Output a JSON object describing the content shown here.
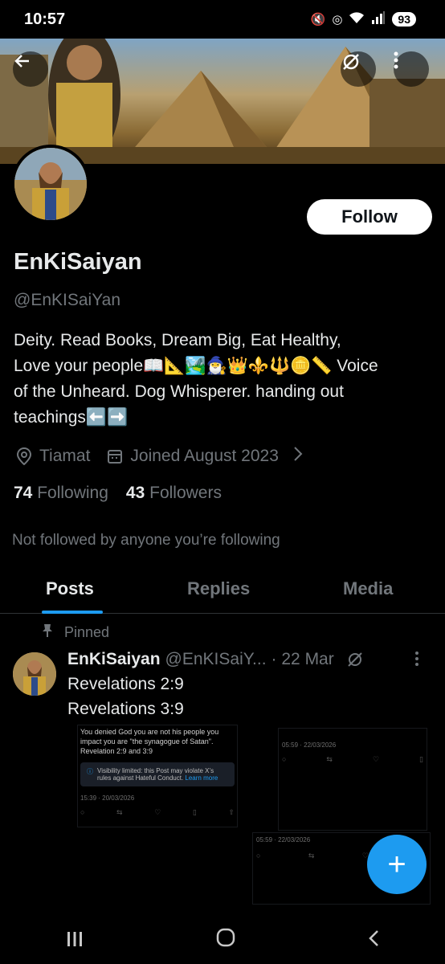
{
  "status": {
    "time": "10:57",
    "battery": "93",
    "icons": [
      "mute-icon",
      "hotspot-icon",
      "wifi-icon",
      "signal-icon"
    ]
  },
  "header": {
    "back_icon": "back-arrow-icon",
    "hide_icon": "eye-slash-icon",
    "more_icon": "more-vertical-icon"
  },
  "profile": {
    "name": "EnKiSaiyan",
    "handle": "@EnKISaiYan",
    "bio_line1": "Deity.   Read Books, Dream Big, Eat Healthy,",
    "bio_line2": "Love your people📖📐🏞️🧙‍♂️👑⚜️🔱🪙📏 Voice",
    "bio_line3": "of the Unheard.   Dog Whisperer.   handing out",
    "bio_line4": "teachings⬅️➡️",
    "location": "Tiamat",
    "joined": "Joined August 2023",
    "following_count": "74",
    "following_label": "Following",
    "followers_count": "43",
    "followers_label": "Followers",
    "not_followed": "Not followed by anyone you’re following",
    "follow_button": "Follow"
  },
  "tabs": [
    {
      "label": "Posts",
      "active": true
    },
    {
      "label": "Replies",
      "active": false
    },
    {
      "label": "Media",
      "active": false
    }
  ],
  "post": {
    "pinned_label": "Pinned",
    "name": "EnKiSaiyan",
    "handle": "@EnKISaiY...",
    "date": "· 22 Mar",
    "line1": "Revelations 2:9",
    "line2": "Revelations 3:9",
    "embed1": {
      "text": "You denied God you are not his people you impact you are \"the synagogue of Satan\". Revelation 2:9 and 3:9",
      "warning": "Visibility limited: this Post may violate X’s rules against Hateful Conduct.",
      "learn_more": "Learn more",
      "timestamp": "15:39 · 20/03/2026"
    },
    "embed2": {
      "timestamp": "05:59 · 22/03/2026"
    },
    "embed3": {
      "timestamp": "05:59 · 22/03/2026"
    }
  },
  "fab": {
    "label": "+"
  },
  "colors": {
    "accent": "#1d9bf0",
    "background": "#000000",
    "secondary_text": "#71767b"
  }
}
